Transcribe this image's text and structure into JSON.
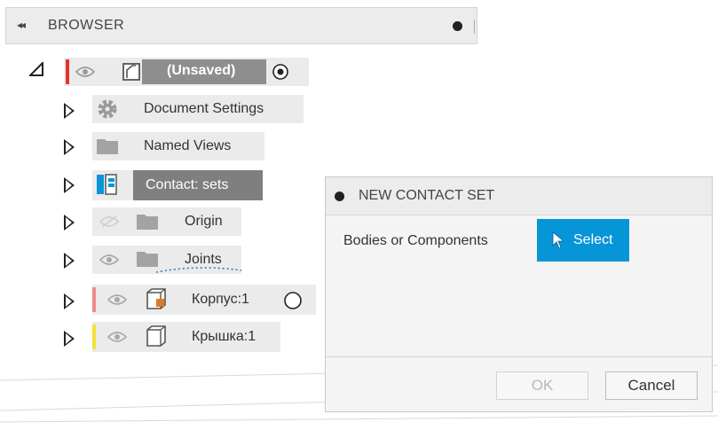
{
  "browser": {
    "collapse_glyph": "◂◂",
    "title": "BROWSER"
  },
  "tree": {
    "root": {
      "label": "(Unsaved)",
      "strip_color": "#e0362c"
    },
    "items": [
      {
        "label": "Document Settings",
        "icon": "gear-icon"
      },
      {
        "label": "Named Views",
        "icon": "folder-icon"
      },
      {
        "label": "Contact: sets",
        "icon": "contact-sets-icon",
        "highlighted": true
      },
      {
        "label": "Origin",
        "icon": "folder-icon",
        "visibility": "hidden"
      },
      {
        "label": "Joints",
        "icon": "folder-icon"
      },
      {
        "label": "Корпус:1",
        "icon": "component-icon",
        "strip_color": "#f08a8a"
      },
      {
        "label": "Крышка:1",
        "icon": "component-icon",
        "strip_color": "#f5e03c"
      }
    ]
  },
  "dialog": {
    "title": "NEW CONTACT SET",
    "field_label": "Bodies or Components",
    "select_label": "Select",
    "ok_label": "OK",
    "cancel_label": "Cancel",
    "accent_color": "#0696d7"
  }
}
